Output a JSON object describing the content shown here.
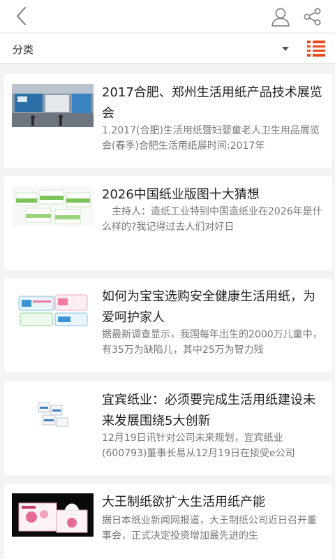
{
  "header": {
    "back_icon": "chevron-left-icon",
    "user_icon": "user-icon",
    "share_icon": "share-icon"
  },
  "filter": {
    "label": "分类",
    "dropdown_icon": "caret-down-icon",
    "view_icon": "list-view-icon",
    "accent_color": "#e84a1b"
  },
  "articles": [
    {
      "title": "2017合肥、郑州生活用纸产品技术展览会",
      "summary": "1.2017(合肥)生活用纸暨妇婴童老人卫生用品展览会(春季)合肥生活用纸展时间:2017年"
    },
    {
      "title": "2026中国纸业版图十大猜想",
      "summary": "　主持人：造纸工业特别中国造纸业在2026年是什么样的?我记得过去人们对好日"
    },
    {
      "title": "如何为宝宝选购安全健康生活用纸，为爱呵护家人",
      "summary": "据最新调查显示，我国每年出生的2000万儿童中，有35万为缺陷儿，其中25万为智力残"
    },
    {
      "title": "宜宾纸业：必须要完成生活用纸建设未来发展围绕5大创新",
      "summary": "12月19日讯针对公司未来规划，宜宾纸业(600793)董事长易从12月19日在接受e公司"
    },
    {
      "title": "大王制纸欲扩大生活用纸产能",
      "summary": "据日本纸业新闻网报道，大王制纸公司近日召开董事会，正式决定投资增加最先进的生"
    }
  ]
}
